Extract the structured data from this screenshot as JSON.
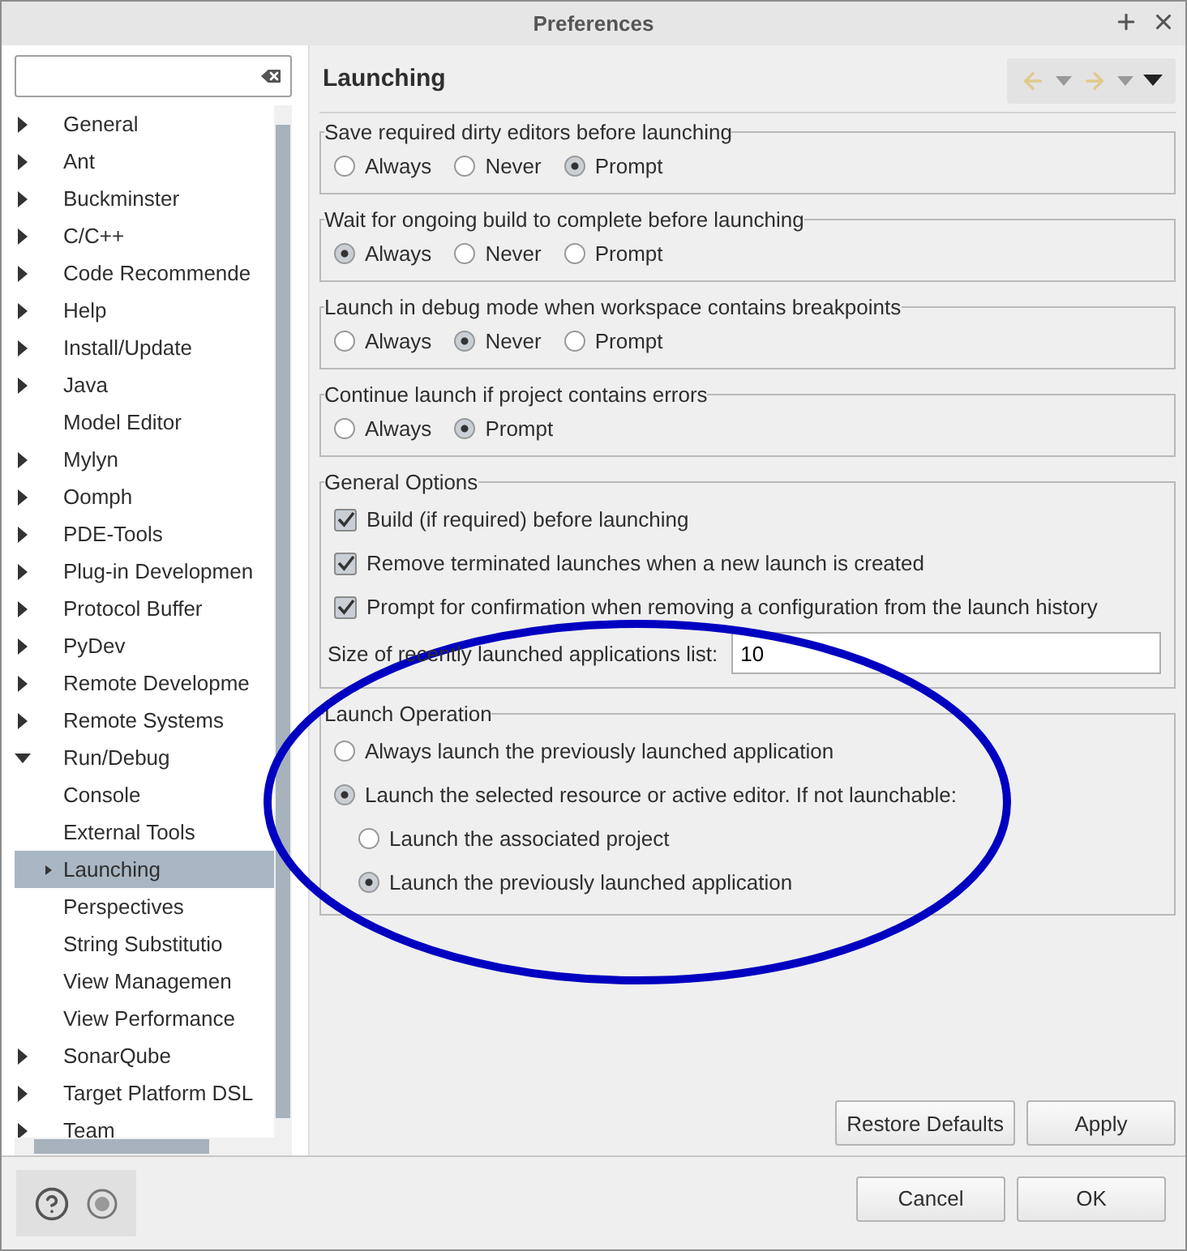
{
  "window": {
    "title": "Preferences"
  },
  "tree": [
    {
      "label": "General",
      "expanded": false,
      "selected": false
    },
    {
      "label": "Ant",
      "expanded": false,
      "selected": false
    },
    {
      "label": "Buckminster",
      "expanded": false,
      "selected": false
    },
    {
      "label": "C/C++",
      "expanded": false,
      "selected": false
    },
    {
      "label": "Code Recommende",
      "expanded": false,
      "selected": false
    },
    {
      "label": "Help",
      "expanded": false,
      "selected": false
    },
    {
      "label": "Install/Update",
      "expanded": false,
      "selected": false
    },
    {
      "label": "Java",
      "expanded": false,
      "selected": false
    },
    {
      "label": "Model Editor",
      "selected": false
    },
    {
      "label": "Mylyn",
      "expanded": false,
      "selected": false
    },
    {
      "label": "Oomph",
      "expanded": false,
      "selected": false
    },
    {
      "label": "PDE-Tools",
      "expanded": false,
      "selected": false
    },
    {
      "label": "Plug-in Developmen",
      "expanded": false,
      "selected": false
    },
    {
      "label": "Protocol Buffer",
      "expanded": false,
      "selected": false
    },
    {
      "label": "PyDev",
      "expanded": false,
      "selected": false
    },
    {
      "label": "Remote Developme",
      "expanded": false,
      "selected": false
    },
    {
      "label": "Remote Systems",
      "expanded": false,
      "selected": false
    },
    {
      "label": "Run/Debug",
      "expanded": true,
      "selected": false,
      "children": [
        {
          "label": "Console",
          "selected": false
        },
        {
          "label": "External Tools",
          "selected": false
        },
        {
          "label": "Launching",
          "expanded": false,
          "selected": true
        },
        {
          "label": "Perspectives",
          "selected": false
        },
        {
          "label": "String Substitutio",
          "selected": false
        },
        {
          "label": "View Managemen",
          "selected": false
        },
        {
          "label": "View Performance",
          "selected": false
        }
      ]
    },
    {
      "label": "SonarQube",
      "expanded": false,
      "selected": false
    },
    {
      "label": "Target Platform DSL",
      "expanded": false,
      "selected": false
    },
    {
      "label": "Team",
      "expanded": false,
      "selected": false
    }
  ],
  "page": {
    "title": "Launching"
  },
  "groups": [
    {
      "kind": "radio",
      "title": "Save required dirty editors before launching",
      "options": [
        {
          "label": "Always",
          "selected": false
        },
        {
          "label": "Never",
          "selected": false
        },
        {
          "label": "Prompt",
          "selected": true
        }
      ]
    },
    {
      "kind": "radio",
      "title": "Wait for ongoing build to complete before launching",
      "options": [
        {
          "label": "Always",
          "selected": true
        },
        {
          "label": "Never",
          "selected": false
        },
        {
          "label": "Prompt",
          "selected": false
        }
      ]
    },
    {
      "kind": "radio",
      "title": "Launch in debug mode when workspace contains breakpoints",
      "options": [
        {
          "label": "Always",
          "selected": false
        },
        {
          "label": "Never",
          "selected": true
        },
        {
          "label": "Prompt",
          "selected": false
        }
      ]
    },
    {
      "kind": "radio",
      "title": "Continue launch if project contains errors",
      "options": [
        {
          "label": "Always",
          "selected": false
        },
        {
          "label": "Prompt",
          "selected": true
        }
      ]
    },
    {
      "kind": "options",
      "title": "General Options",
      "checks": [
        {
          "label": "Build (if required) before launching",
          "checked": true
        },
        {
          "label": "Remove terminated launches when a new launch is created",
          "checked": true
        },
        {
          "label": "Prompt for confirmation when removing a configuration from the launch history",
          "checked": true
        }
      ],
      "field": {
        "label": "Size of recently launched applications list:",
        "value": "10"
      }
    },
    {
      "kind": "stack",
      "title": "Launch Operation",
      "options": [
        {
          "label": "Always launch the previously launched application",
          "selected": false
        },
        {
          "label": "Launch the selected resource or active editor. If not launchable:",
          "selected": true,
          "children": [
            {
              "label": "Launch the associated project",
              "selected": false
            },
            {
              "label": "Launch the previously launched application",
              "selected": true
            }
          ]
        }
      ]
    }
  ],
  "page_buttons": [
    "Restore Defaults",
    "Apply"
  ],
  "dialog_buttons": [
    "Cancel",
    "OK"
  ]
}
